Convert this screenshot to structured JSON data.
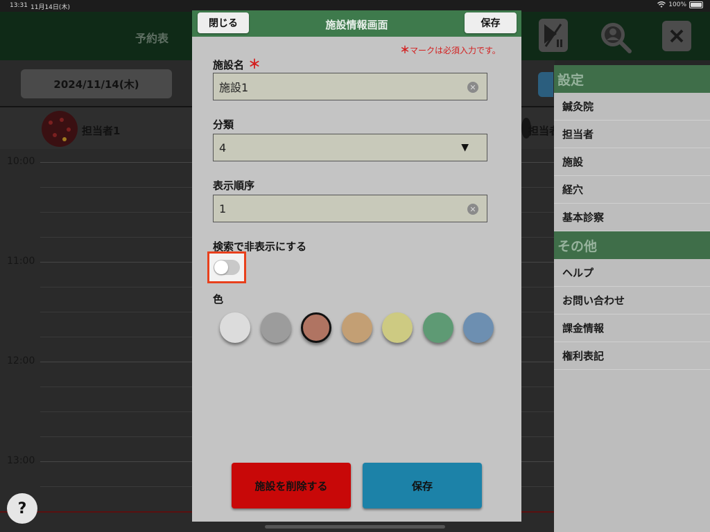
{
  "status": {
    "time": "13:31",
    "date": "11月14日(木)",
    "battery": "100%"
  },
  "background": {
    "title": "予約表",
    "date_button": "2024/11/14(木)",
    "staff": [
      "担当者1",
      "担当者"
    ],
    "time_labels": [
      "10:00",
      "11:00",
      "12:00",
      "13:00"
    ],
    "help_label": "?"
  },
  "menu": {
    "sections": [
      {
        "title": "設定",
        "items": [
          "鍼灸院",
          "担当者",
          "施設",
          "経穴",
          "基本診察"
        ]
      },
      {
        "title": "その他",
        "items": [
          "ヘルプ",
          "お問い合わせ",
          "課金情報",
          "権利表記"
        ]
      }
    ]
  },
  "modal": {
    "title": "施設情報画面",
    "close_label": "閉じる",
    "save_header_label": "保存",
    "required_note": "マークは必須入力です。",
    "required_mark": "＊",
    "name": {
      "label": "施設名",
      "value": "施設1"
    },
    "category": {
      "label": "分類",
      "value": "4"
    },
    "order": {
      "label": "表示順序",
      "value": "1"
    },
    "hide_toggle": {
      "label": "検索で非表示にする",
      "on": false
    },
    "color": {
      "label": "色",
      "options": [
        "#dcdcdc",
        "#9c9c9c",
        "#b07462",
        "#c39f74",
        "#cdca82",
        "#5e9a74",
        "#6d8fb1"
      ],
      "selected": 2
    },
    "delete_label": "施設を削除する",
    "save_label": "保存"
  },
  "colors": {
    "accent_green": "#3e7a4c",
    "danger": "#c80808",
    "primary": "#1c82a8",
    "highlight": "#e8401c"
  }
}
